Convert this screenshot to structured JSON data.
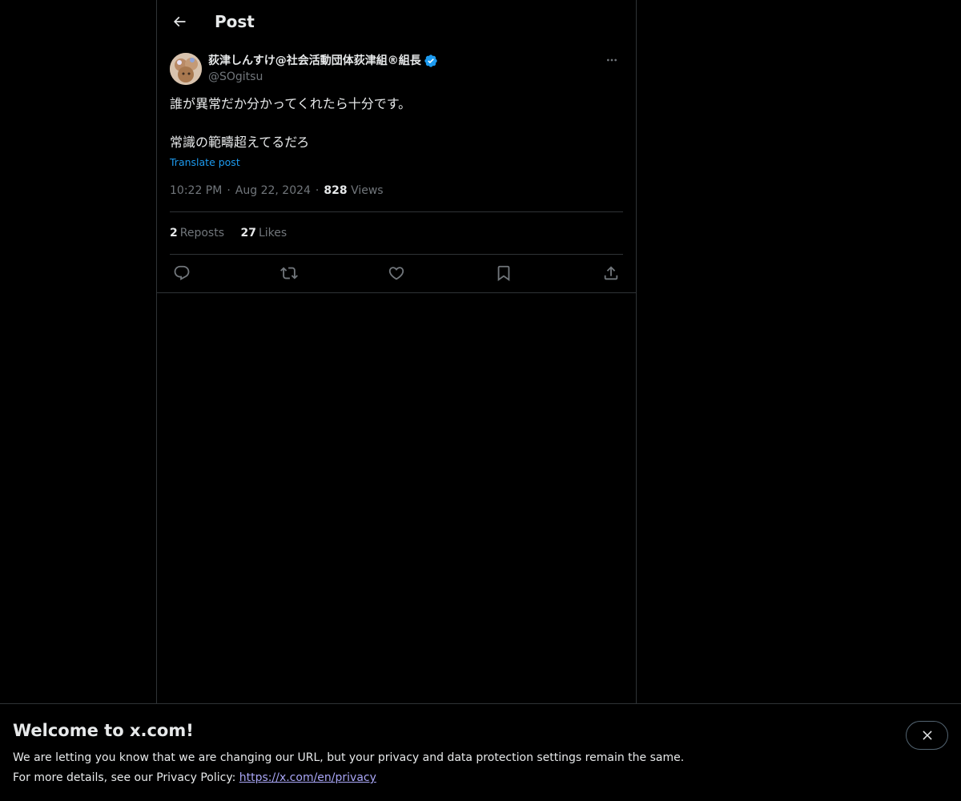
{
  "header": {
    "title": "Post",
    "back_icon": "arrow-left-icon"
  },
  "post": {
    "author_name": "荻津しんすけ@社会活動団体荻津組®組長",
    "author_handle": "@SOgitsu",
    "verified": true,
    "verified_color": "#1d9bf0",
    "text_line1": "誰が異常だか分かってくれたら十分です。",
    "text_line2": "常識の範疇超えてるだろ",
    "translate_label": "Translate post",
    "time": "10:22 PM",
    "date": "Aug 22, 2024",
    "views_count": "828",
    "views_label": "Views",
    "reposts_count": "2",
    "reposts_label": "Reposts",
    "likes_count": "27",
    "likes_label": "Likes"
  },
  "actions": [
    {
      "name": "reply",
      "icon": "reply-icon"
    },
    {
      "name": "repost",
      "icon": "repost-icon"
    },
    {
      "name": "like",
      "icon": "heart-icon"
    },
    {
      "name": "bookmark",
      "icon": "bookmark-icon"
    },
    {
      "name": "share",
      "icon": "share-icon"
    }
  ],
  "banner": {
    "title": "Welcome to x.com!",
    "line1": "We are letting you know that we are changing our URL, but your privacy and data protection settings remain the same.",
    "line2_prefix": "For more details, see our Privacy Policy: ",
    "link_text": "https://x.com/en/privacy",
    "close_icon": "close-icon"
  },
  "colors": {
    "background": "#000000",
    "text_primary": "#e7e9ea",
    "text_secondary": "#71767b",
    "accent": "#1d9bf0",
    "border": "#2f3336",
    "link": "#a9a6f6"
  }
}
